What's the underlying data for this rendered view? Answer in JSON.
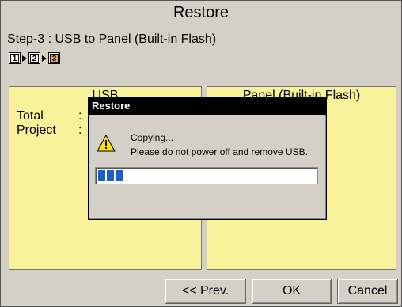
{
  "header": {
    "title": "Restore"
  },
  "step": {
    "text": "Step-3 : USB to Panel (Built-in Flash)"
  },
  "steps": [
    {
      "label": "1",
      "active": false
    },
    {
      "label": "2",
      "active": false
    },
    {
      "label": "3",
      "active": true
    }
  ],
  "left_panel": {
    "title": "USB",
    "rows": [
      {
        "label": "Total",
        "sep": ":"
      },
      {
        "label": "Project",
        "sep": ":"
      }
    ]
  },
  "right_panel": {
    "title": "Panel (Built-in Flash)"
  },
  "dialog": {
    "title": "Restore",
    "line1": "Copying...",
    "line2": "Please do not power off and remove USB.",
    "progress_segments": 3
  },
  "footer": {
    "prev_label": "<< Prev.",
    "ok_label": "OK",
    "cancel_label": "Cancel"
  },
  "colors": {
    "panel_bg": "#f8f29a",
    "active_step": "#f4a356",
    "progress": "#1d5fc9"
  }
}
